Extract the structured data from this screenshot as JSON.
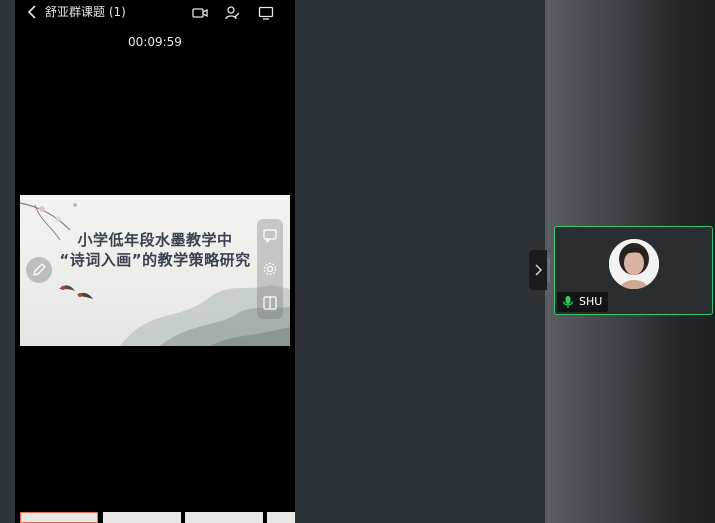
{
  "header": {
    "title": "舒亚群课题 (1)",
    "timer": "00:09:59"
  },
  "slide": {
    "line1": "小学低年段水墨教学中",
    "line2": "“诗词入画”的教学策略研究"
  },
  "participant": {
    "name": "SHU",
    "mic": "on"
  },
  "colors": {
    "active_border": "#3fc36d",
    "mic": "#33c75a"
  },
  "icons": [
    "back-chevron-icon",
    "video-camera-icon",
    "edit-user-icon",
    "screen-icon",
    "comment-icon",
    "settings-icon",
    "split-view-icon",
    "pencil-icon",
    "chevron-right-icon",
    "microphone-icon"
  ]
}
